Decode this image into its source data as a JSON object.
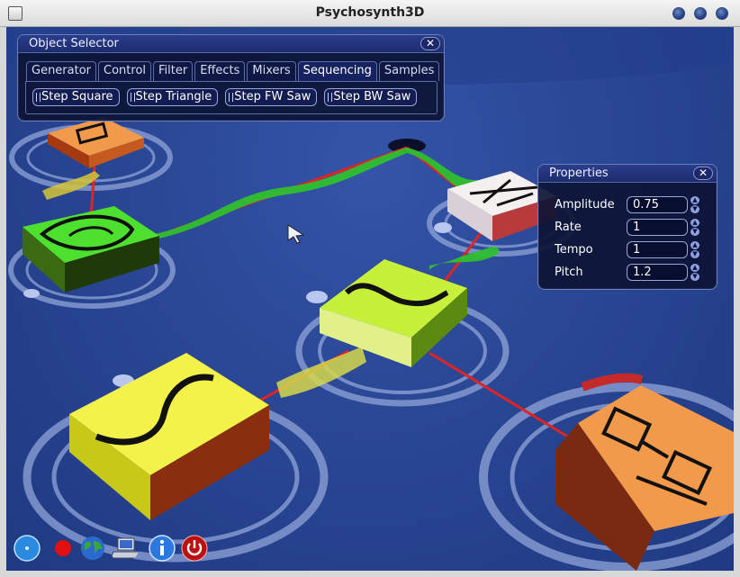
{
  "window": {
    "title": "Psychosynth3D"
  },
  "object_selector": {
    "title": "Object Selector",
    "close_glyph": "✕",
    "tabs": [
      {
        "label": "Generator",
        "active": false
      },
      {
        "label": "Control",
        "active": false
      },
      {
        "label": "Filter",
        "active": false
      },
      {
        "label": "Effects",
        "active": false
      },
      {
        "label": "Mixers",
        "active": false
      },
      {
        "label": "Sequencing",
        "active": true
      },
      {
        "label": "Samples",
        "active": false
      }
    ],
    "options": [
      "Step Square",
      "Step Triangle",
      "Step FW Saw",
      "Step BW Saw"
    ]
  },
  "properties": {
    "title": "Properties",
    "close_glyph": "✕",
    "fields": [
      {
        "label": "Amplitude",
        "value": "0.75"
      },
      {
        "label": "Rate",
        "value": "1"
      },
      {
        "label": "Tempo",
        "value": "1"
      },
      {
        "label": "Pitch",
        "value": "1.2"
      }
    ]
  },
  "toolbar": {
    "buttons": [
      "record-dot-icon",
      "record-icon",
      "globe-icon",
      "network-icon",
      "info-icon",
      "power-icon"
    ]
  },
  "colors": {
    "background": "#2a4795",
    "panel": "#0c1434",
    "module_yellow": "#f2f24a",
    "module_lime": "#c6f03a",
    "module_green": "#4ee02e",
    "module_orange": "#f29a4c",
    "module_white": "#f4f0f0",
    "link_red": "#e02424"
  }
}
